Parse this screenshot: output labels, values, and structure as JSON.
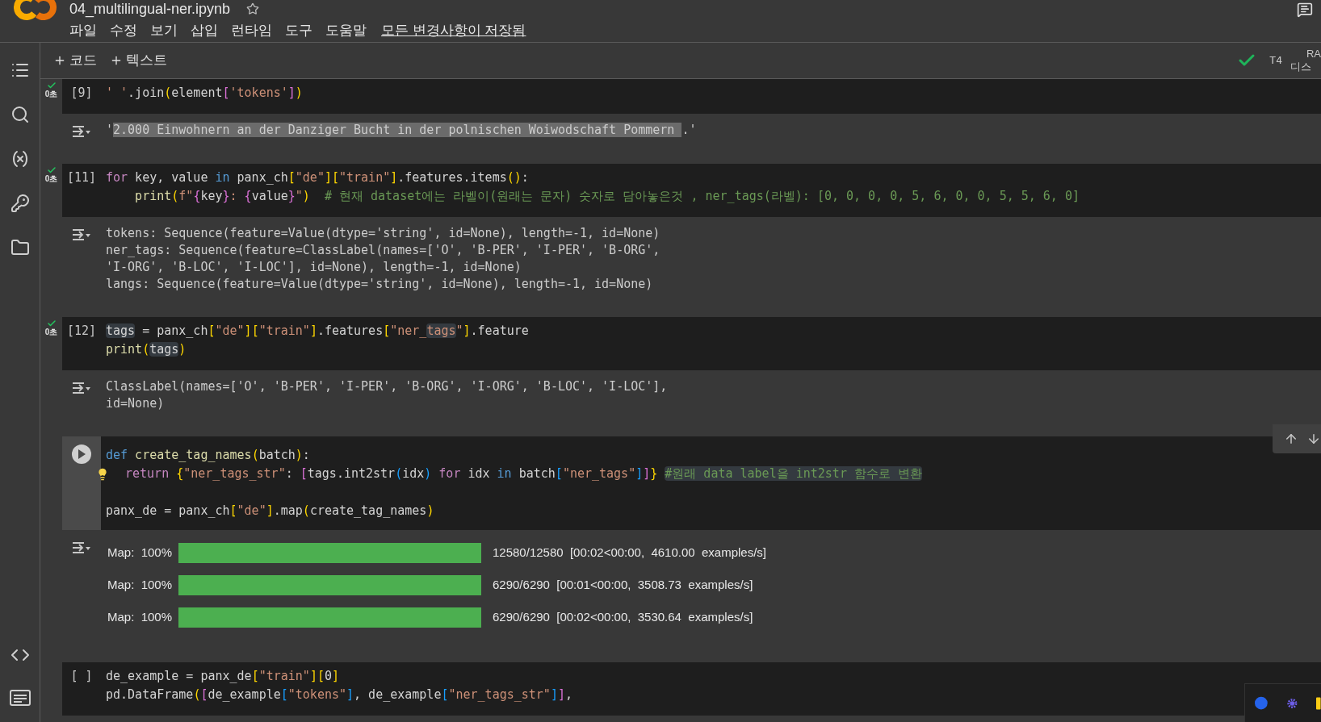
{
  "header": {
    "title": "04_multilingual-ner.ipynb",
    "menu": [
      "파일",
      "수정",
      "보기",
      "삽입",
      "런타임",
      "도구",
      "도움말"
    ],
    "save_status": "모든 변경사항이 저장됨"
  },
  "toolbar": {
    "buttons": [
      "코드",
      "텍스트"
    ],
    "runtime": {
      "connected": true,
      "type": "T4",
      "ram": "RA",
      "disk": "디스"
    }
  },
  "cells": [
    {
      "kind": "code",
      "exec": "[9]",
      "ran": true,
      "time": "0초",
      "focused": false,
      "lines": [
        {
          "tokens": [
            {
              "text": "' '",
              "kind": "string"
            },
            {
              "text": ".join",
              "kind": "plain"
            },
            {
              "text": "(",
              "kind": "bracket1"
            },
            {
              "text": "element",
              "kind": "plain"
            },
            {
              "text": "[",
              "kind": "bracket2"
            },
            {
              "text": "'tokens'",
              "kind": "string"
            },
            {
              "text": "]",
              "kind": "bracket2"
            },
            {
              "text": ")",
              "kind": "bracket1"
            }
          ]
        }
      ],
      "output": {
        "kind": "text",
        "lines": [
          {
            "tokens": [
              {
                "text": "'",
                "kind": "plain"
              },
              {
                "text": "2.000 Einwohnern an der Danziger Bucht in der polnischen Woiwodschaft Pommern ",
                "kind": "plain",
                "highlighted": true
              },
              {
                "text": ".'",
                "kind": "plain"
              }
            ]
          }
        ]
      }
    },
    {
      "kind": "code",
      "exec": "[11]",
      "ran": true,
      "time": "0초",
      "focused": false,
      "lines": [
        {
          "tokens": [
            {
              "text": "for",
              "kind": "keyword"
            },
            {
              "text": " key, value ",
              "kind": "plain"
            },
            {
              "text": "in",
              "kind": "keyword2"
            },
            {
              "text": " panx_ch",
              "kind": "plain"
            },
            {
              "text": "[",
              "kind": "bracket1"
            },
            {
              "text": "\"de\"",
              "kind": "string"
            },
            {
              "text": "]",
              "kind": "bracket1"
            },
            {
              "text": "[",
              "kind": "bracket1"
            },
            {
              "text": "\"train\"",
              "kind": "string"
            },
            {
              "text": "]",
              "kind": "bracket1"
            },
            {
              "text": ".features.items",
              "kind": "plain"
            },
            {
              "text": "()",
              "kind": "bracket1"
            },
            {
              "text": ":",
              "kind": "plain"
            }
          ]
        },
        {
          "tokens": [
            {
              "text": "    print",
              "kind": "function"
            },
            {
              "text": "(",
              "kind": "bracket1"
            },
            {
              "text": "f\"",
              "kind": "string"
            },
            {
              "text": "{",
              "kind": "bracket2"
            },
            {
              "text": "key",
              "kind": "plain"
            },
            {
              "text": "}",
              "kind": "bracket2"
            },
            {
              "text": ": ",
              "kind": "string"
            },
            {
              "text": "{",
              "kind": "bracket2"
            },
            {
              "text": "value",
              "kind": "plain"
            },
            {
              "text": "}",
              "kind": "bracket2"
            },
            {
              "text": "\"",
              "kind": "string"
            },
            {
              "text": ")",
              "kind": "bracket1"
            },
            {
              "text": "  # 현재 dataset에는 라벨이(원래는 문자) 숫자로 담아놓은것 , ner_tags(라벨): [0, 0, 0, 0, 5, 6, 0, 0, 5, 5, 6, 0]",
              "kind": "comment"
            }
          ]
        }
      ],
      "output": {
        "kind": "text",
        "lines": [
          {
            "tokens": [
              {
                "text": "tokens: Sequence(feature=Value(dtype='string', id=None), length=-1, id=None)",
                "kind": "plain"
              }
            ]
          },
          {
            "tokens": [
              {
                "text": "ner_tags: Sequence(feature=ClassLabel(names=['O', 'B-PER', 'I-PER', 'B-ORG',",
                "kind": "plain"
              }
            ]
          },
          {
            "tokens": [
              {
                "text": "'I-ORG', 'B-LOC', 'I-LOC'], id=None), length=-1, id=None)",
                "kind": "plain"
              }
            ]
          },
          {
            "tokens": [
              {
                "text": "langs: Sequence(feature=Value(dtype='string', id=None), length=-1, id=None)",
                "kind": "plain"
              }
            ]
          }
        ]
      }
    },
    {
      "kind": "code",
      "exec": "[12]",
      "ran": true,
      "time": "0초",
      "focused": false,
      "lines": [
        {
          "tokens": [
            {
              "text": "tags",
              "kind": "plain",
              "highlighted": true
            },
            {
              "text": " = panx_ch",
              "kind": "plain"
            },
            {
              "text": "[",
              "kind": "bracket1"
            },
            {
              "text": "\"de\"",
              "kind": "string"
            },
            {
              "text": "]",
              "kind": "bracket1"
            },
            {
              "text": "[",
              "kind": "bracket1"
            },
            {
              "text": "\"train\"",
              "kind": "string"
            },
            {
              "text": "]",
              "kind": "bracket1"
            },
            {
              "text": ".features",
              "kind": "plain"
            },
            {
              "text": "[",
              "kind": "bracket1"
            },
            {
              "text": "\"ner_",
              "kind": "string"
            },
            {
              "text": "tags",
              "kind": "string",
              "highlighted": true
            },
            {
              "text": "\"",
              "kind": "string"
            },
            {
              "text": "]",
              "kind": "bracket1"
            },
            {
              "text": ".feature",
              "kind": "plain"
            }
          ]
        },
        {
          "tokens": [
            {
              "text": "print",
              "kind": "function"
            },
            {
              "text": "(",
              "kind": "bracket1"
            },
            {
              "text": "tags",
              "kind": "plain",
              "highlighted": true
            },
            {
              "text": ")",
              "kind": "bracket1"
            }
          ]
        }
      ],
      "output": {
        "kind": "text",
        "lines": [
          {
            "tokens": [
              {
                "text": "ClassLabel(names=['O', 'B-PER', 'I-PER', 'B-ORG', 'I-ORG', 'B-LOC', 'I-LOC'],",
                "kind": "plain"
              }
            ]
          },
          {
            "tokens": [
              {
                "text": "id=None)",
                "kind": "plain"
              }
            ]
          }
        ]
      }
    },
    {
      "kind": "code",
      "focused": true,
      "lines": [
        {
          "tokens": [
            {
              "text": "def",
              "kind": "keyword2"
            },
            {
              "text": " create_tag_names",
              "kind": "function"
            },
            {
              "text": "(",
              "kind": "bracket1"
            },
            {
              "text": "batch",
              "kind": "plain"
            },
            {
              "text": ")",
              "kind": "bracket1"
            },
            {
              "text": ":",
              "kind": "plain"
            }
          ]
        },
        {
          "hint": true,
          "tokens": [
            {
              "text": "return",
              "kind": "keyword"
            },
            {
              "text": " {",
              "kind": "bracket1"
            },
            {
              "text": "\"ner_tags_str\"",
              "kind": "string"
            },
            {
              "text": ": ",
              "kind": "plain"
            },
            {
              "text": "[",
              "kind": "bracket2"
            },
            {
              "text": "tags.int2str",
              "kind": "plain"
            },
            {
              "text": "(",
              "kind": "bracket3"
            },
            {
              "text": "idx",
              "kind": "plain"
            },
            {
              "text": ")",
              "kind": "bracket3"
            },
            {
              "text": " for",
              "kind": "keyword"
            },
            {
              "text": " idx ",
              "kind": "plain"
            },
            {
              "text": "in",
              "kind": "keyword2"
            },
            {
              "text": " batch",
              "kind": "plain"
            },
            {
              "text": "[",
              "kind": "bracket3"
            },
            {
              "text": "\"ner_tags\"",
              "kind": "string"
            },
            {
              "text": "]",
              "kind": "bracket3"
            },
            {
              "text": "]",
              "kind": "bracket2"
            },
            {
              "text": "} ",
              "kind": "bracket1"
            },
            {
              "text": "#원래 data label을 int2str 함수로 변환",
              "kind": "comment",
              "highlighted": true
            }
          ]
        },
        {
          "gap_before": true,
          "tokens": [
            {
              "text": "panx_de = panx_ch",
              "kind": "plain"
            },
            {
              "text": "[",
              "kind": "bracket1"
            },
            {
              "text": "\"de\"",
              "kind": "string"
            },
            {
              "text": "]",
              "kind": "bracket1"
            },
            {
              "text": ".map",
              "kind": "plain"
            },
            {
              "text": "(",
              "kind": "bracket1"
            },
            {
              "text": "create_tag_names",
              "kind": "plain"
            },
            {
              "text": ")",
              "kind": "bracket1"
            }
          ]
        }
      ],
      "output": {
        "kind": "progress",
        "rows": [
          {
            "label": "Map:  100%",
            "level": 1,
            "stats": "12580/12580  [00:02<00:00,  4610.00  examples/s]"
          },
          {
            "label": "Map:  100%",
            "level": 1,
            "stats": "6290/6290  [00:01<00:00,  3508.73  examples/s]"
          },
          {
            "label": "Map:  100%",
            "level": 1,
            "stats": "6290/6290  [00:02<00:00,  3530.64  examples/s]"
          }
        ]
      }
    },
    {
      "kind": "code",
      "exec": "[ ]",
      "ran": false,
      "focused": false,
      "lines": [
        {
          "tokens": [
            {
              "text": "de_example = panx_de",
              "kind": "plain"
            },
            {
              "text": "[",
              "kind": "bracket1"
            },
            {
              "text": "\"train\"",
              "kind": "string"
            },
            {
              "text": "]",
              "kind": "bracket1"
            },
            {
              "text": "[",
              "kind": "bracket1"
            },
            {
              "text": "0",
              "kind": "plain"
            },
            {
              "text": "]",
              "kind": "bracket1"
            }
          ]
        },
        {
          "tokens": [
            {
              "text": "pd.DataFrame",
              "kind": "plain"
            },
            {
              "text": "(",
              "kind": "bracket1"
            },
            {
              "text": "[",
              "kind": "bracket2"
            },
            {
              "text": "de_example",
              "kind": "plain"
            },
            {
              "text": "[",
              "kind": "bracket3"
            },
            {
              "text": "\"tokens\"",
              "kind": "string"
            },
            {
              "text": "]",
              "kind": "bracket3"
            },
            {
              "text": ", de_example",
              "kind": "plain"
            },
            {
              "text": "[",
              "kind": "bracket3"
            },
            {
              "text": "\"ner_tags_str\"",
              "kind": "string"
            },
            {
              "text": "]",
              "kind": "bracket3"
            },
            {
              "text": "]",
              "kind": "bracket2"
            },
            {
              "text": ",",
              "kind": "plain"
            }
          ]
        }
      ]
    }
  ]
}
